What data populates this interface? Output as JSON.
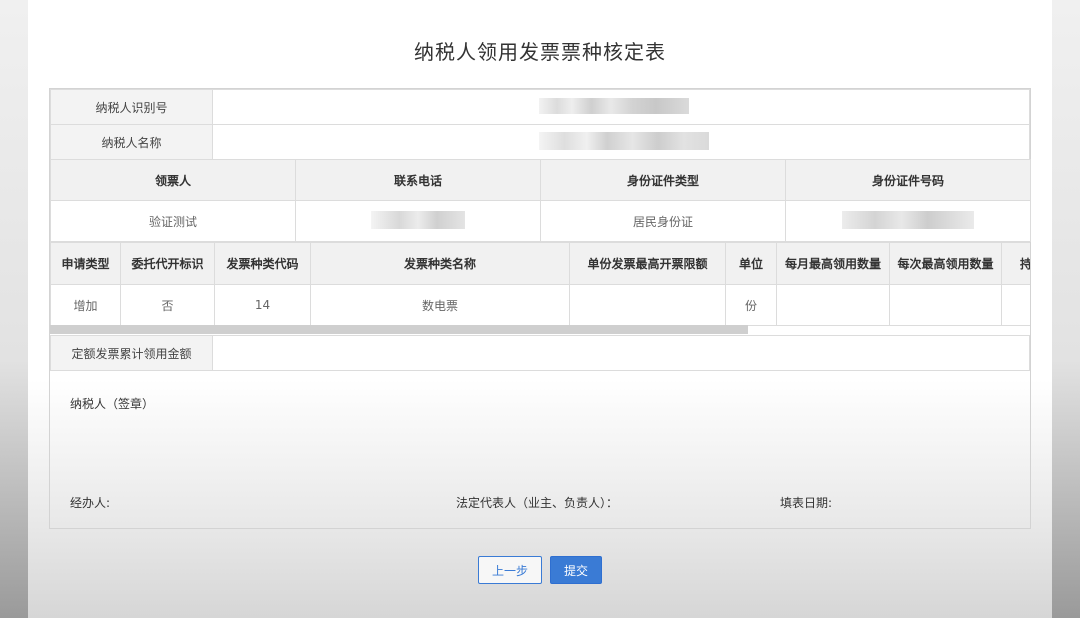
{
  "title": "纳税人领用发票票种核定表",
  "taxpayer": {
    "id_label": "纳税人识别号",
    "name_label": "纳税人名称"
  },
  "contact": {
    "headers": [
      "领票人",
      "联系电话",
      "身份证件类型",
      "身份证件号码"
    ],
    "row": {
      "receiver": "验证测试",
      "id_type": "居民身份证"
    }
  },
  "items": {
    "headers": [
      "申请类型",
      "委托代开标识",
      "发票种类代码",
      "发票种类名称",
      "单份发票最高开票限额",
      "单位",
      "每月最高领用数量",
      "每次最高领用数量",
      "持"
    ],
    "rows": [
      {
        "apply_type": "增加",
        "entrust": "否",
        "code": "14",
        "name": "数电票",
        "limit": "",
        "unit": "份",
        "monthly": "",
        "each": ""
      }
    ]
  },
  "amount": {
    "label": "定额发票累计领用金额",
    "value": ""
  },
  "signature": {
    "seal_label": "纳税人（签章）",
    "handler_label": "经办人:",
    "legal_rep_label": "法定代表人（业主、负责人）：",
    "date_label": "填表日期:"
  },
  "buttons": {
    "prev": "上一步",
    "submit": "提交"
  }
}
